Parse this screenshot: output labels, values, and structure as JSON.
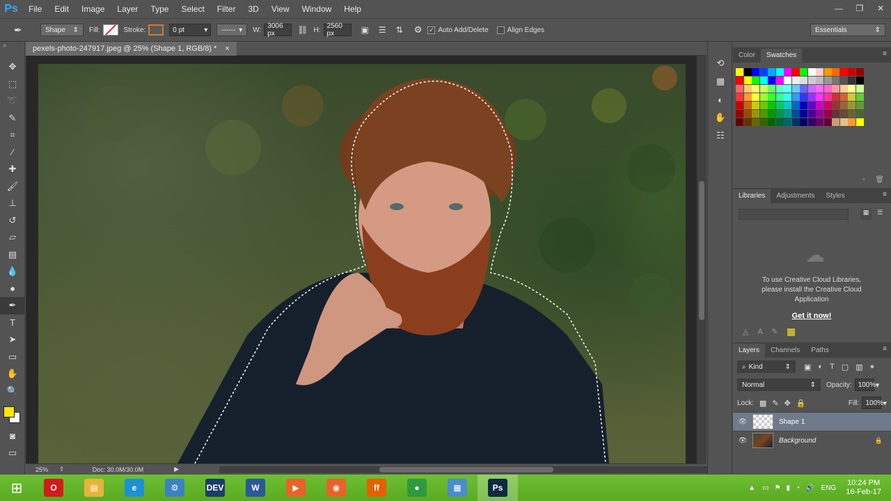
{
  "app": {
    "logo": "Ps"
  },
  "menu": [
    "File",
    "Edit",
    "Image",
    "Layer",
    "Type",
    "Select",
    "Filter",
    "3D",
    "View",
    "Window",
    "Help"
  ],
  "window_controls": {
    "minimize": "—",
    "restore": "❐",
    "close": "✕"
  },
  "options": {
    "mode": "Shape",
    "fill_label": "Fill:",
    "stroke_label": "Stroke:",
    "stroke_width": "0 pt",
    "w_label": "W:",
    "w_value": "3006 px",
    "h_label": "H:",
    "h_value": "2560 px",
    "auto_add_delete": "Auto Add/Delete",
    "align_edges": "Align Edges",
    "workspace": "Essentials"
  },
  "document": {
    "tab_title": "pexels-photo-247917.jpeg @ 25% (Shape 1, RGB/8) *",
    "tab_close": "×",
    "zoom": "25%",
    "doc_info": "Doc: 30.0M/30.0M"
  },
  "swatches_panel": {
    "tabs": [
      "Color",
      "Swatches"
    ],
    "active_tab": "Swatches"
  },
  "libraries_panel": {
    "tabs": [
      "Libraries",
      "Adjustments",
      "Styles"
    ],
    "message": "To use Creative Cloud Libraries, please install the Creative Cloud Application",
    "link": "Get it now!"
  },
  "layers_panel": {
    "tabs": [
      "Layers",
      "Channels",
      "Paths"
    ],
    "filter": "Kind",
    "blend_mode": "Normal",
    "opacity_label": "Opacity:",
    "opacity": "100%",
    "lock_label": "Lock:",
    "fill_label": "Fill:",
    "fill": "100%",
    "layers": [
      {
        "name": "Shape 1",
        "selected": true
      },
      {
        "name": "Background",
        "selected": false
      }
    ]
  },
  "taskbar": {
    "apps": [
      {
        "name": "Opera",
        "label": "O",
        "color": "#d21c1c"
      },
      {
        "name": "File Explorer",
        "label": "▤",
        "color": "#e8b33a"
      },
      {
        "name": "Internet Explorer",
        "label": "e",
        "color": "#1e90d6"
      },
      {
        "name": "Control Panel",
        "label": "⚙",
        "color": "#3a82c4"
      },
      {
        "name": "Dev",
        "label": "DEV",
        "color": "#1b3c6b"
      },
      {
        "name": "Word",
        "label": "W",
        "color": "#2b579a"
      },
      {
        "name": "Presenter",
        "label": "▶",
        "color": "#e8622a"
      },
      {
        "name": "Recorder",
        "label": "◉",
        "color": "#e8622a"
      },
      {
        "name": "Firefox",
        "label": "ff",
        "color": "#e66000"
      },
      {
        "name": "Chrome",
        "label": "●",
        "color": "#2e9a3e"
      },
      {
        "name": "Photos",
        "label": "▦",
        "color": "#4a8ccc"
      },
      {
        "name": "Photoshop",
        "label": "Ps",
        "color": "#0d2a44"
      }
    ],
    "language": "ENG",
    "time": "10:24 PM",
    "date": "16-Feb-17"
  }
}
